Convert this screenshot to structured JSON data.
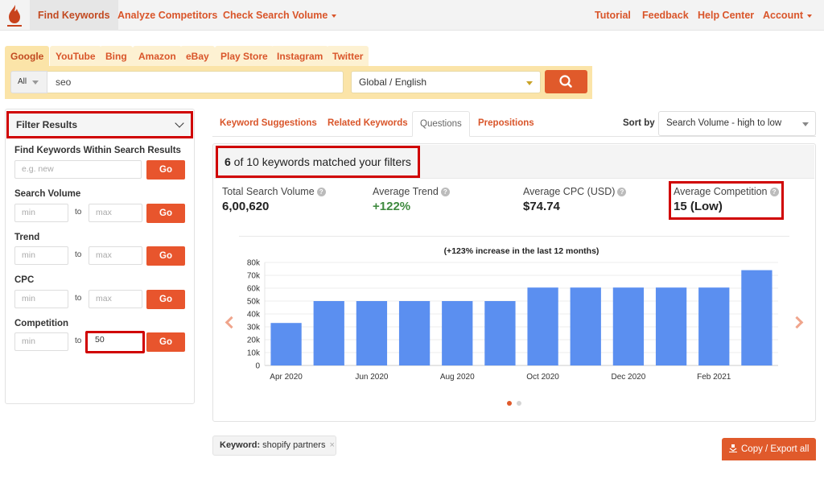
{
  "topnav": {
    "items": [
      {
        "label": "Find Keywords",
        "active": true
      },
      {
        "label": "Analyze Competitors"
      },
      {
        "label": "Check Search Volume",
        "dropdown": true
      }
    ],
    "right_items": [
      {
        "label": "Tutorial"
      },
      {
        "label": "Feedback"
      },
      {
        "label": "Help Center"
      },
      {
        "label": "Account",
        "dropdown": true
      }
    ]
  },
  "search": {
    "engine_tabs": [
      "Google",
      "YouTube",
      "Bing",
      "Amazon",
      "eBay",
      "Play Store",
      "Instagram",
      "Twitter"
    ],
    "active_engine": "Google",
    "mode_select": "All",
    "keyword_value": "seo",
    "location_select": "Global / English",
    "search_icon": "search-icon"
  },
  "filters": {
    "title": "Filter Results",
    "find_within": {
      "label": "Find Keywords Within Search Results",
      "placeholder": "e.g. new",
      "go": "Go"
    },
    "groups": [
      {
        "label": "Search Volume",
        "min_placeholder": "min",
        "max_placeholder": "max",
        "to": "to",
        "go": "Go",
        "max_value": ""
      },
      {
        "label": "Trend",
        "min_placeholder": "min",
        "max_placeholder": "max",
        "to": "to",
        "go": "Go",
        "max_value": ""
      },
      {
        "label": "CPC",
        "min_placeholder": "min",
        "max_placeholder": "max",
        "to": "to",
        "go": "Go",
        "max_value": ""
      },
      {
        "label": "Competition",
        "min_placeholder": "min",
        "max_placeholder": "max",
        "to": "to",
        "go": "Go",
        "max_value": "50"
      }
    ]
  },
  "content": {
    "tabs": [
      "Keyword Suggestions",
      "Related Keywords",
      "Questions",
      "Prepositions"
    ],
    "active_tab": "Questions",
    "sort_label": "Sort by",
    "sort_value": "Search Volume - high to low",
    "matched": {
      "count": "6",
      "rest": " of 10 keywords matched your filters"
    },
    "stats": [
      {
        "label": "Total Search Volume",
        "value": "6,00,620"
      },
      {
        "label": "Average Trend",
        "value": "+122%"
      },
      {
        "label": "Average CPC (USD)",
        "value": "$74.74"
      },
      {
        "label": "Average Competition",
        "value": "15 (Low)"
      }
    ],
    "help_glyph": "?",
    "carousel_dots": 2,
    "active_dot": 0
  },
  "colors": {
    "accent": "#e05a2b",
    "bar": "#5b8ff0",
    "highlight": "#d00000",
    "trend_green": "#3f8a3f"
  },
  "chart_data": {
    "type": "bar",
    "title": "(+123% increase in the last 12 months)",
    "categories": [
      "Apr 2020",
      "May 2020",
      "Jun 2020",
      "Jul 2020",
      "Aug 2020",
      "Sep 2020",
      "Oct 2020",
      "Nov 2020",
      "Dec 2020",
      "Jan 2021",
      "Feb 2021",
      "Mar 2021"
    ],
    "tick_labels_x": [
      "Apr 2020",
      "",
      "Jun 2020",
      "",
      "Aug 2020",
      "",
      "Oct 2020",
      "",
      "Dec 2020",
      "",
      "Feb 2021",
      ""
    ],
    "values": [
      33000,
      50000,
      50000,
      50000,
      50000,
      50000,
      60500,
      60500,
      60500,
      60500,
      60500,
      74000
    ],
    "y_ticks": [
      0,
      10000,
      20000,
      30000,
      40000,
      50000,
      60000,
      70000,
      80000
    ],
    "y_tick_labels": [
      "0",
      "10k",
      "20k",
      "30k",
      "40k",
      "50k",
      "60k",
      "70k",
      "80k"
    ],
    "ylim": [
      0,
      80000
    ],
    "xlabel": "",
    "ylabel": "",
    "grid": true,
    "legend": "none"
  },
  "footer": {
    "chip_label": "Keyword:",
    "chip_value": " shopify partners",
    "chip_close": "×",
    "export_label": "Copy / Export all"
  }
}
